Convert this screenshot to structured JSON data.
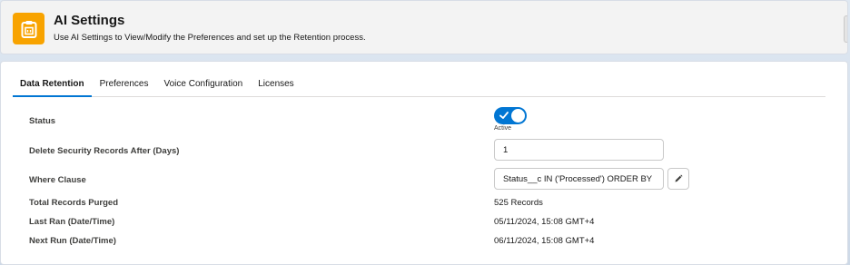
{
  "header": {
    "title": "AI Settings",
    "subtitle": "Use AI Settings to View/Modify the Preferences and set up the Retention process.",
    "icon": "clipboard-icon",
    "icon_color": "#f8a300"
  },
  "tabs": [
    {
      "label": "Data Retention",
      "active": true
    },
    {
      "label": "Preferences",
      "active": false
    },
    {
      "label": "Voice Configuration",
      "active": false
    },
    {
      "label": "Licenses",
      "active": false
    }
  ],
  "form": {
    "status": {
      "label": "Status",
      "toggle_on": true,
      "toggle_caption": "Active"
    },
    "delete_after": {
      "label": "Delete Security Records After (Days)",
      "value": "1"
    },
    "where_clause": {
      "label": "Where Clause",
      "value": "Status__c IN ('Processed') ORDER BY CreatedDate",
      "edit_icon": "pencil-icon"
    },
    "total_purged": {
      "label": "Total Records Purged",
      "value": "525 Records"
    },
    "last_ran": {
      "label": "Last Ran (Date/Time)",
      "value": "05/11/2024, 15:08 GMT+4"
    },
    "next_run": {
      "label": "Next Run (Date/Time)",
      "value": "06/11/2024, 15:08 GMT+4"
    }
  },
  "colors": {
    "accent": "#0176d3",
    "label": "#3e3e3c"
  }
}
